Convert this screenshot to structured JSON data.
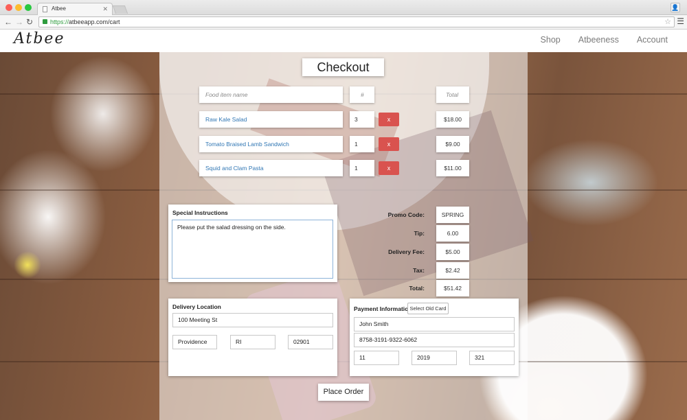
{
  "browser": {
    "tab_title": "Atbee",
    "url_scheme": "https://",
    "url_rest": "atbeeapp.com/cart"
  },
  "site": {
    "logo_text": "Atbee",
    "nav": [
      "Shop",
      "Atbeeness",
      "Account"
    ]
  },
  "checkout": {
    "title": "Checkout",
    "header": {
      "name_placeholder": "Food item name",
      "qty_placeholder": "#",
      "total_placeholder": "Total"
    },
    "items": [
      {
        "name": "Raw Kale Salad",
        "qty": "3",
        "remove_label": "x",
        "price": "$18.00"
      },
      {
        "name": "Tomato Braised Lamb Sandwich",
        "qty": "1",
        "remove_label": "x",
        "price": "$9.00"
      },
      {
        "name": "Squid and Clam Pasta",
        "qty": "1",
        "remove_label": "x",
        "price": "$11.00"
      }
    ],
    "special_instructions": {
      "label": "Special Instructions",
      "value": "Please put the salad dressing on the side."
    },
    "summary": {
      "promo_label": "Promo Code:",
      "promo_value": "SPRING",
      "tip_label": "Tip:",
      "tip_value": "6.00",
      "delivery_label": "Delivery Fee:",
      "delivery_value": "$5.00",
      "tax_label": "Tax:",
      "tax_value": "$2.42",
      "total_label": "Total:",
      "total_value": "$51.42"
    },
    "delivery": {
      "label": "Delivery Location",
      "address": "100 Meeting St",
      "city": "Providence",
      "state": "RI",
      "zip": "02901"
    },
    "payment": {
      "label": "Payment Information",
      "select_old_card": "Select Old Card",
      "name": "John Smith",
      "card_number": "8758-3191-9322-6062",
      "exp_month": "11",
      "exp_year": "2019",
      "cvv": "321"
    },
    "place_order": "Place Order"
  }
}
